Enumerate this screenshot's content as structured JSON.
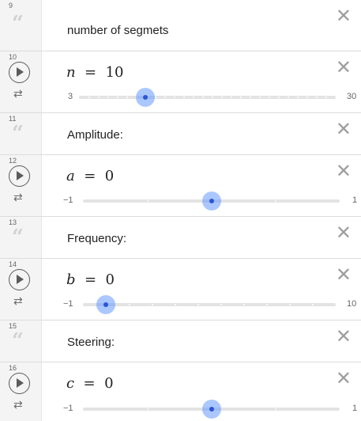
{
  "rows": [
    {
      "num": "9",
      "type": "text",
      "label": "number of segmets"
    },
    {
      "num": "10",
      "type": "slider",
      "var": "n",
      "value": "10",
      "min": "3",
      "max": "30",
      "fraction": 0.259
    },
    {
      "num": "11",
      "type": "text",
      "label": "Amplitude:"
    },
    {
      "num": "12",
      "type": "slider",
      "var": "a",
      "value": "0",
      "min": "−1",
      "max": "1",
      "fraction": 0.5
    },
    {
      "num": "13",
      "type": "text",
      "label": "Frequency:"
    },
    {
      "num": "14",
      "type": "slider",
      "var": "b",
      "value": "0",
      "min": "−1",
      "max": "10",
      "fraction": 0.091
    },
    {
      "num": "15",
      "type": "text",
      "label": "Steering:"
    },
    {
      "num": "16",
      "type": "slider",
      "var": "c",
      "value": "0",
      "min": "−1",
      "max": "1",
      "fraction": 0.5
    }
  ],
  "icons": {
    "quote": "quote-icon",
    "play": "play-icon",
    "repeat": "repeat-icon",
    "close": "close-icon"
  },
  "colors": {
    "accent": "#2a56d6",
    "thumb_halo": "#6699ff",
    "track": "#e3e3e3"
  }
}
